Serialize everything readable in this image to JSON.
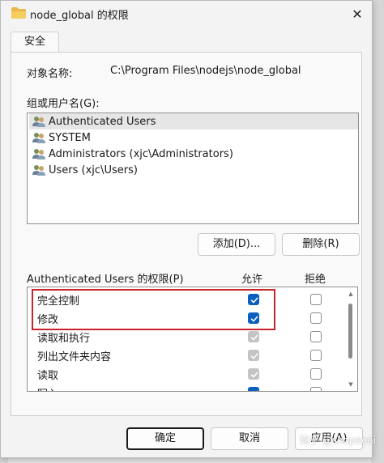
{
  "window": {
    "title": "node_global 的权限",
    "close_glyph": "✕"
  },
  "tabs": [
    {
      "label": "安全"
    }
  ],
  "object": {
    "label": "对象名称:",
    "value": "C:\\Program Files\\nodejs\\node_global"
  },
  "groups": {
    "label": "组或用户名(G):",
    "items": [
      {
        "name": "Authenticated Users",
        "icon": "users-icon",
        "selected": true
      },
      {
        "name": "SYSTEM",
        "icon": "users-icon",
        "selected": false
      },
      {
        "name": "Administrators (xjc\\Administrators)",
        "icon": "users-icon",
        "selected": false
      },
      {
        "name": "Users (xjc\\Users)",
        "icon": "users-icon",
        "selected": false
      }
    ],
    "add_button": "添加(D)...",
    "remove_button": "删除(R)"
  },
  "permissions": {
    "title": "Authenticated Users 的权限(P)",
    "allow_header": "允许",
    "deny_header": "拒绝",
    "rows": [
      {
        "name": "完全控制",
        "allow": "checked",
        "deny": "empty"
      },
      {
        "name": "修改",
        "allow": "checked",
        "deny": "empty"
      },
      {
        "name": "读取和执行",
        "allow": "checked-disabled",
        "deny": "empty"
      },
      {
        "name": "列出文件夹内容",
        "allow": "checked-disabled",
        "deny": "empty"
      },
      {
        "name": "读取",
        "allow": "checked-disabled",
        "deny": "empty"
      },
      {
        "name": "写入",
        "allow": "checked",
        "deny": "empty"
      }
    ]
  },
  "footer": {
    "ok": "确定",
    "cancel": "取消",
    "apply": "应用(A)"
  },
  "watermark": "知乎 @shopeeai",
  "colors": {
    "accent": "#0a5fbf",
    "highlight": "#c8242b",
    "folder": "#e8b84a"
  }
}
